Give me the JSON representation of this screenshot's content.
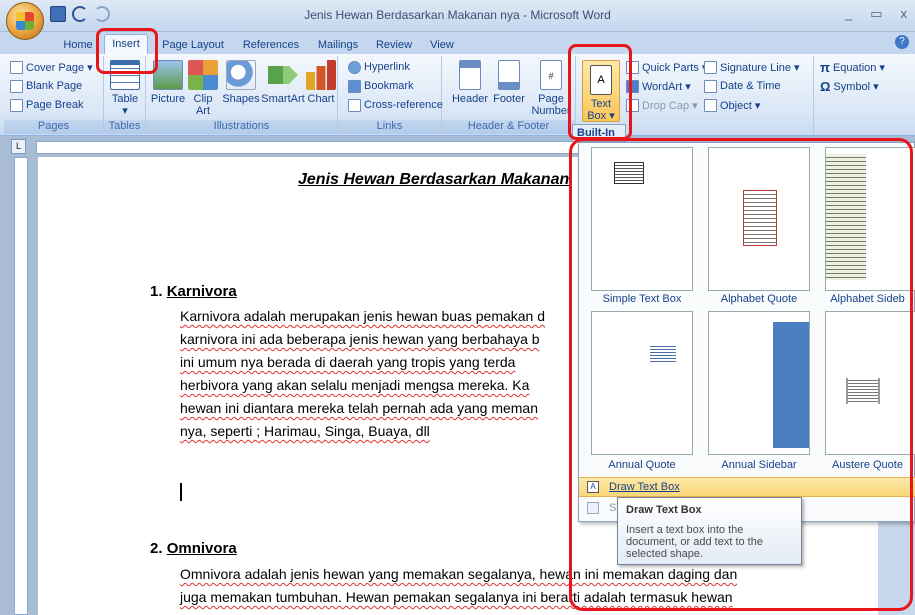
{
  "window": {
    "title": "Jenis Hewan Berdasarkan Makanan nya - Microsoft Word",
    "controls": [
      "_",
      "▭",
      "x"
    ]
  },
  "tabs": [
    "Home",
    "Insert",
    "Page Layout",
    "References",
    "Mailings",
    "Review",
    "View"
  ],
  "ribbon": {
    "pages": {
      "label": "Pages",
      "cover_page": "Cover Page ▾",
      "blank_page": "Blank Page",
      "page_break": "Page Break"
    },
    "tables": {
      "label": "Tables",
      "table": "Table",
      "arrow": "▾"
    },
    "illustrations": {
      "label": "Illustrations",
      "picture": "Picture",
      "clip_art_1": "Clip",
      "clip_art_2": "Art",
      "shapes": "Shapes",
      "smartart": "SmartArt",
      "chart": "Chart"
    },
    "links": {
      "label": "Links",
      "hyperlink": "Hyperlink",
      "bookmark": "Bookmark",
      "cross_reference": "Cross-reference"
    },
    "header_footer": {
      "label": "Header & Footer",
      "header": "Header",
      "footer": "Footer",
      "page_number_1": "Page",
      "page_number_2": "Number ▾"
    },
    "text": {
      "text_box_1": "Text",
      "text_box_2": "Box ▾",
      "quick_parts": "Quick Parts ▾",
      "wordart": "WordArt ▾",
      "drop_cap": "Drop Cap ▾",
      "signature_line": "Signature Line ▾",
      "date_time": "Date & Time",
      "object": "Object ▾"
    },
    "symbols": {
      "equation": "Equation ▾",
      "symbol": "Symbol ▾"
    }
  },
  "gallery": {
    "section": "Built-In",
    "items": [
      {
        "label": "Simple Text Box"
      },
      {
        "label": "Alphabet Quote"
      },
      {
        "label": "Alphabet Sideb"
      },
      {
        "label": "Annual Quote"
      },
      {
        "label": "Annual Sidebar"
      },
      {
        "label": "Austere Quote"
      }
    ],
    "draw_text_box": "Draw Text Box",
    "save_selection": "S"
  },
  "tooltip": {
    "title": "Draw Text Box",
    "body": "Insert a text box into the document, or add text to the selected shape."
  },
  "document": {
    "heading": "Jenis Hewan Berdasarkan Makanan",
    "sections": [
      {
        "number": "1.",
        "title": "Karnivora",
        "lines": [
          "Karnivora adalah merupakan jenis hewan buas pemakan d",
          "karnivora ini ada beberapa jenis hewan yang berbahaya b",
          "ini umum nya berada di daerah yang tropis yang terda",
          "herbivora yang akan selalu menjadi mengsa mereka. Ka",
          "hewan ini diantara mereka telah pernah ada yang meman",
          "nya, seperti ; Harimau, Singa, Buaya, dll"
        ]
      },
      {
        "number": "2.",
        "title": "Omnivora",
        "lines": [
          "Omnivora adalah jenis hewan yang memakan segalanya, hewan ini memakan daging dan",
          "juga memakan tumbuhan. Hewan pemakan segalanya ini berarti adalah termasuk hewan"
        ]
      }
    ]
  },
  "colors": {
    "highlight": "#e8161a",
    "ribbon_text": "#15428b",
    "hover": "#fbd77a"
  }
}
